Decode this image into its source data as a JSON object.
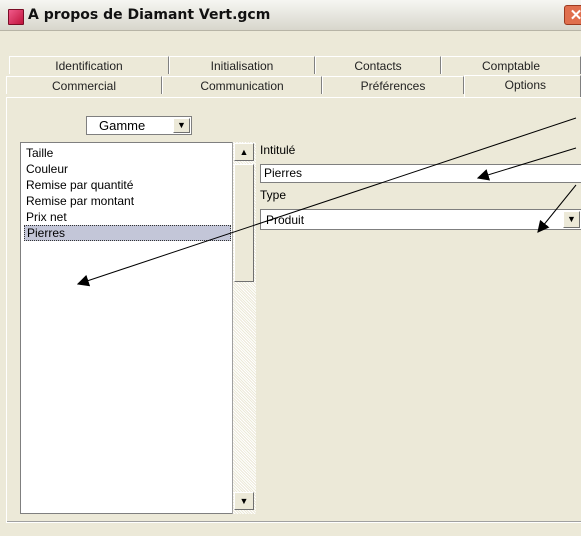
{
  "window": {
    "title": "A propos de Diamant Vert.gcm",
    "close_glyph": "✕"
  },
  "tabs_row1": [
    "Identification",
    "Initialisation",
    "Contacts",
    "Comptable"
  ],
  "tabs_row2": [
    "Commercial",
    "Communication",
    "Préférences",
    "Options"
  ],
  "active_tab": "Options",
  "gamme_select": {
    "value": "Gamme"
  },
  "list": {
    "items": [
      "Taille",
      "Couleur",
      "Remise par quantité",
      "Remise par montant",
      "Prix net",
      "Pierres"
    ],
    "selected_index": 5
  },
  "form": {
    "intitule_label": "Intitulé",
    "intitule_value": "Pierres",
    "type_label": "Type",
    "type_value": "Produit"
  },
  "icons": {
    "combo_arrow": "▼",
    "scroll_up": "▲",
    "scroll_down": "▼"
  },
  "colors": {
    "window_bg": "#ece9d8",
    "selection": "#c3c6d8",
    "close_button": "#e06f4e",
    "app_icon": "#d8245a"
  }
}
